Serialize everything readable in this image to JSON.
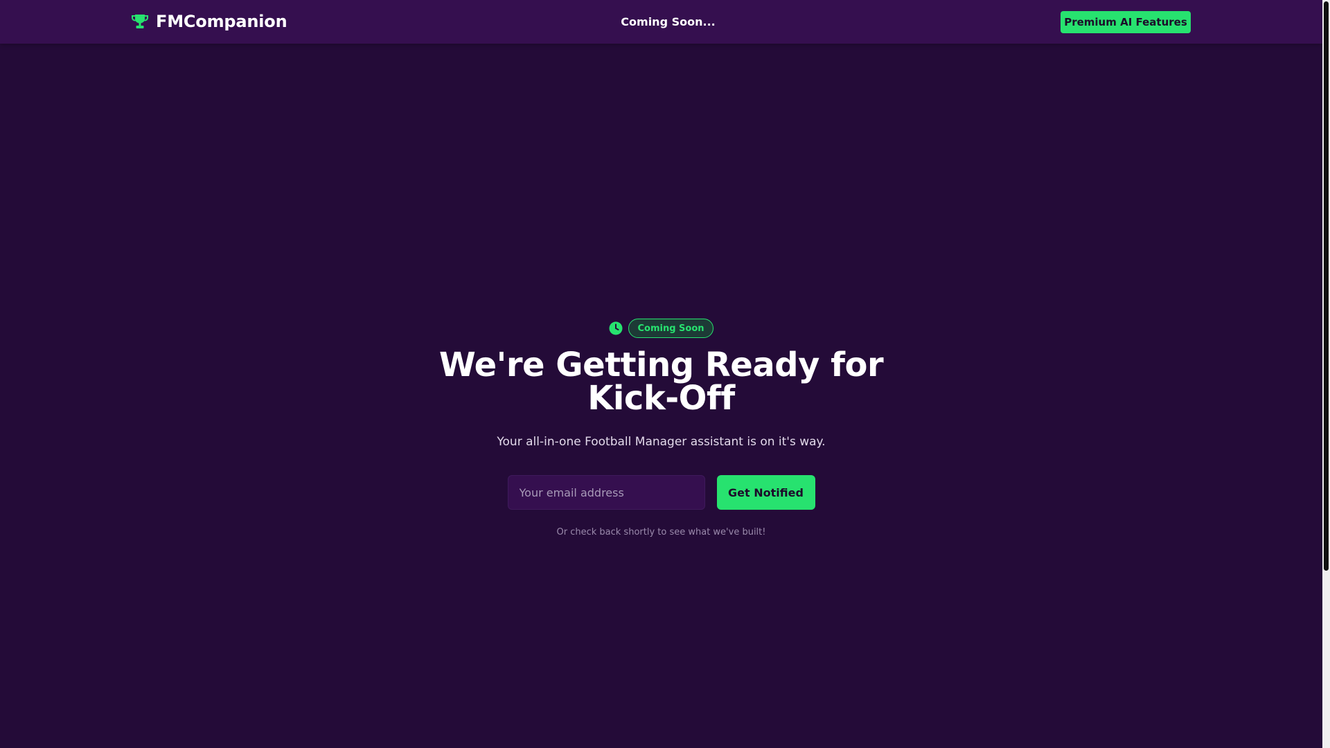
{
  "navbar": {
    "brand_name": "FMCompanion",
    "brand_icon": "trophy-icon",
    "center_text": "Coming Soon...",
    "premium_button_label": "Premium AI Features"
  },
  "hero": {
    "badge_icon": "clock-icon",
    "badge_label": "Coming Soon",
    "title_line1": "We're Getting Ready for",
    "title_line2": "Kick-Off",
    "subtitle": "Your all-in-one Football Manager assistant is on it's way.",
    "email_placeholder": "Your email address",
    "email_value": "",
    "notify_button_label": "Get Notified",
    "footnote": "Or check back shortly to see what we've built!"
  },
  "colors": {
    "background": "#240b38",
    "navbar": "#350f4f",
    "accent": "#27e26f",
    "text": "#ffffff",
    "muted_text": "#9a8aab"
  }
}
